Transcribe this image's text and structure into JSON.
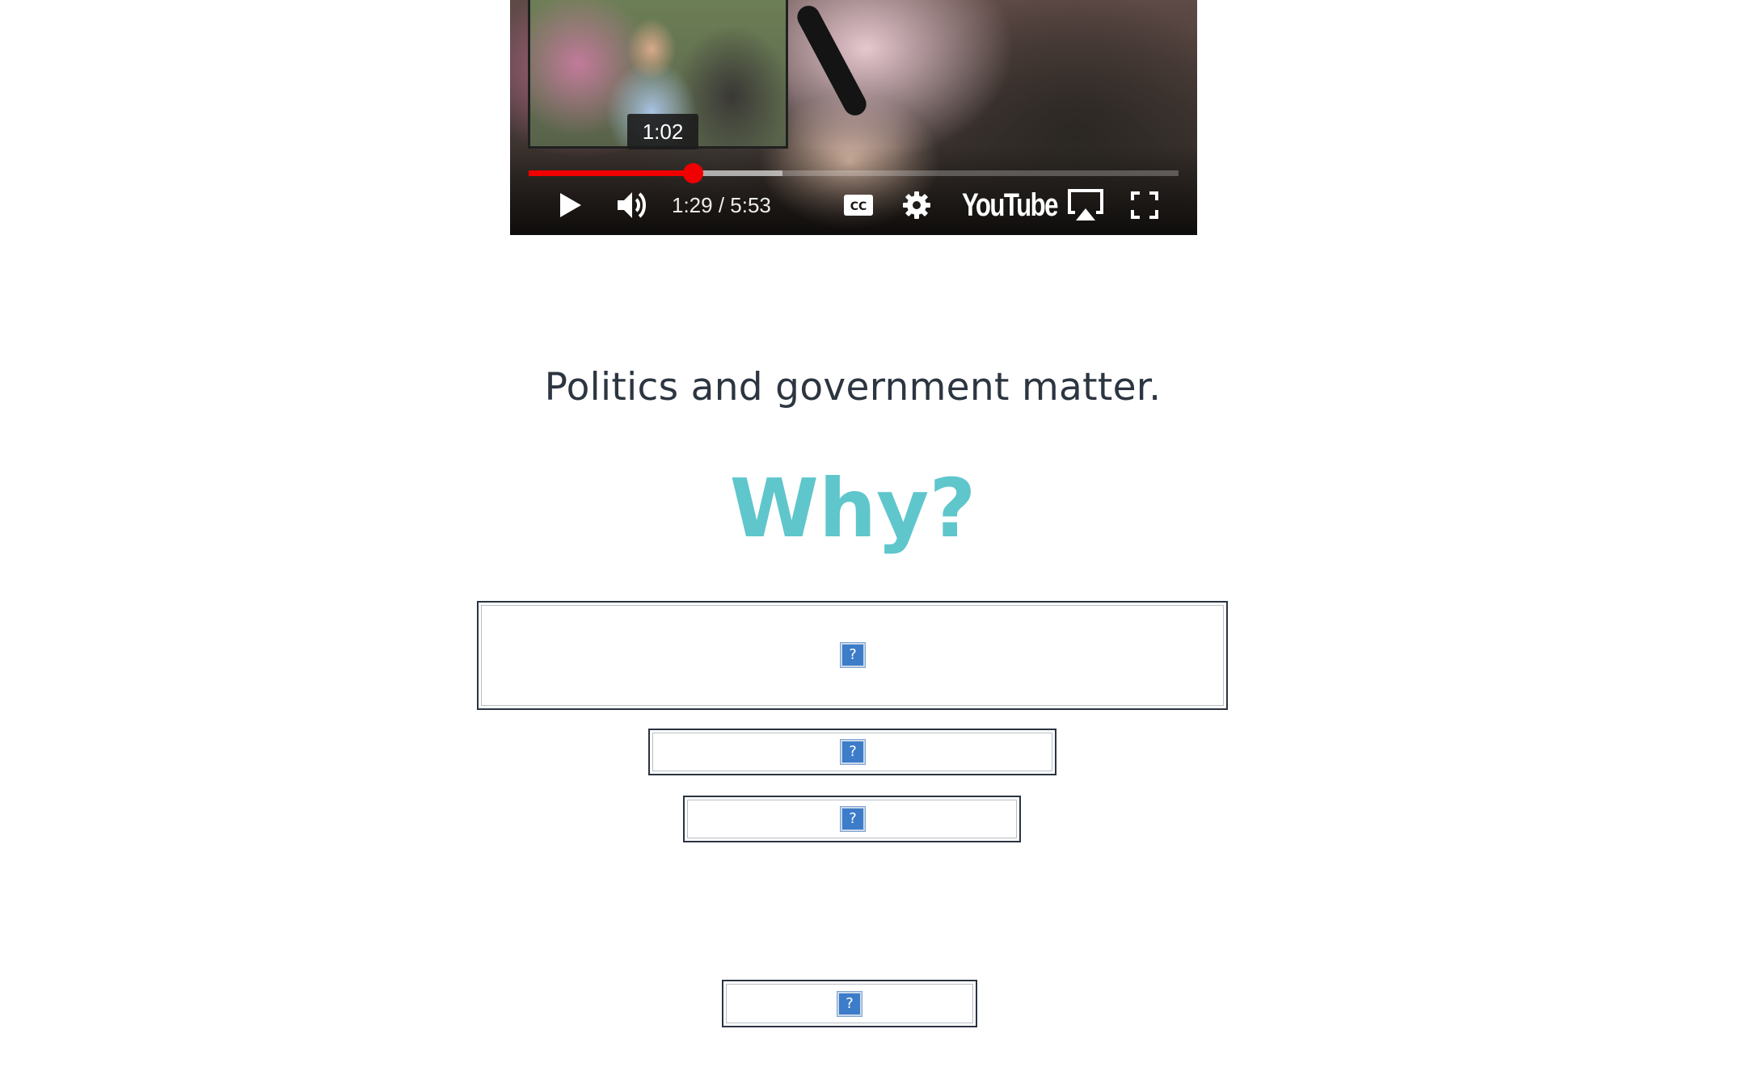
{
  "video": {
    "tooltip_time": "1:02",
    "time_display": "1:29 / 5:53",
    "current_time": "1:29",
    "duration": "5:53",
    "progress_fraction": 0.253,
    "buffered_fraction": 0.39,
    "progress_color": "#f00000",
    "brand_logo": "YouTube",
    "icons": [
      "play-icon",
      "volume-icon",
      "closed-captions-icon",
      "settings-gear-icon",
      "airplay-icon",
      "fullscreen-icon"
    ]
  },
  "content": {
    "subtitle": "Politics and government matter.",
    "heading": "Why?",
    "heading_color": "#5fc6cc",
    "text_color": "#2c3540"
  },
  "images": {
    "broken_icon_glyph": "?"
  }
}
